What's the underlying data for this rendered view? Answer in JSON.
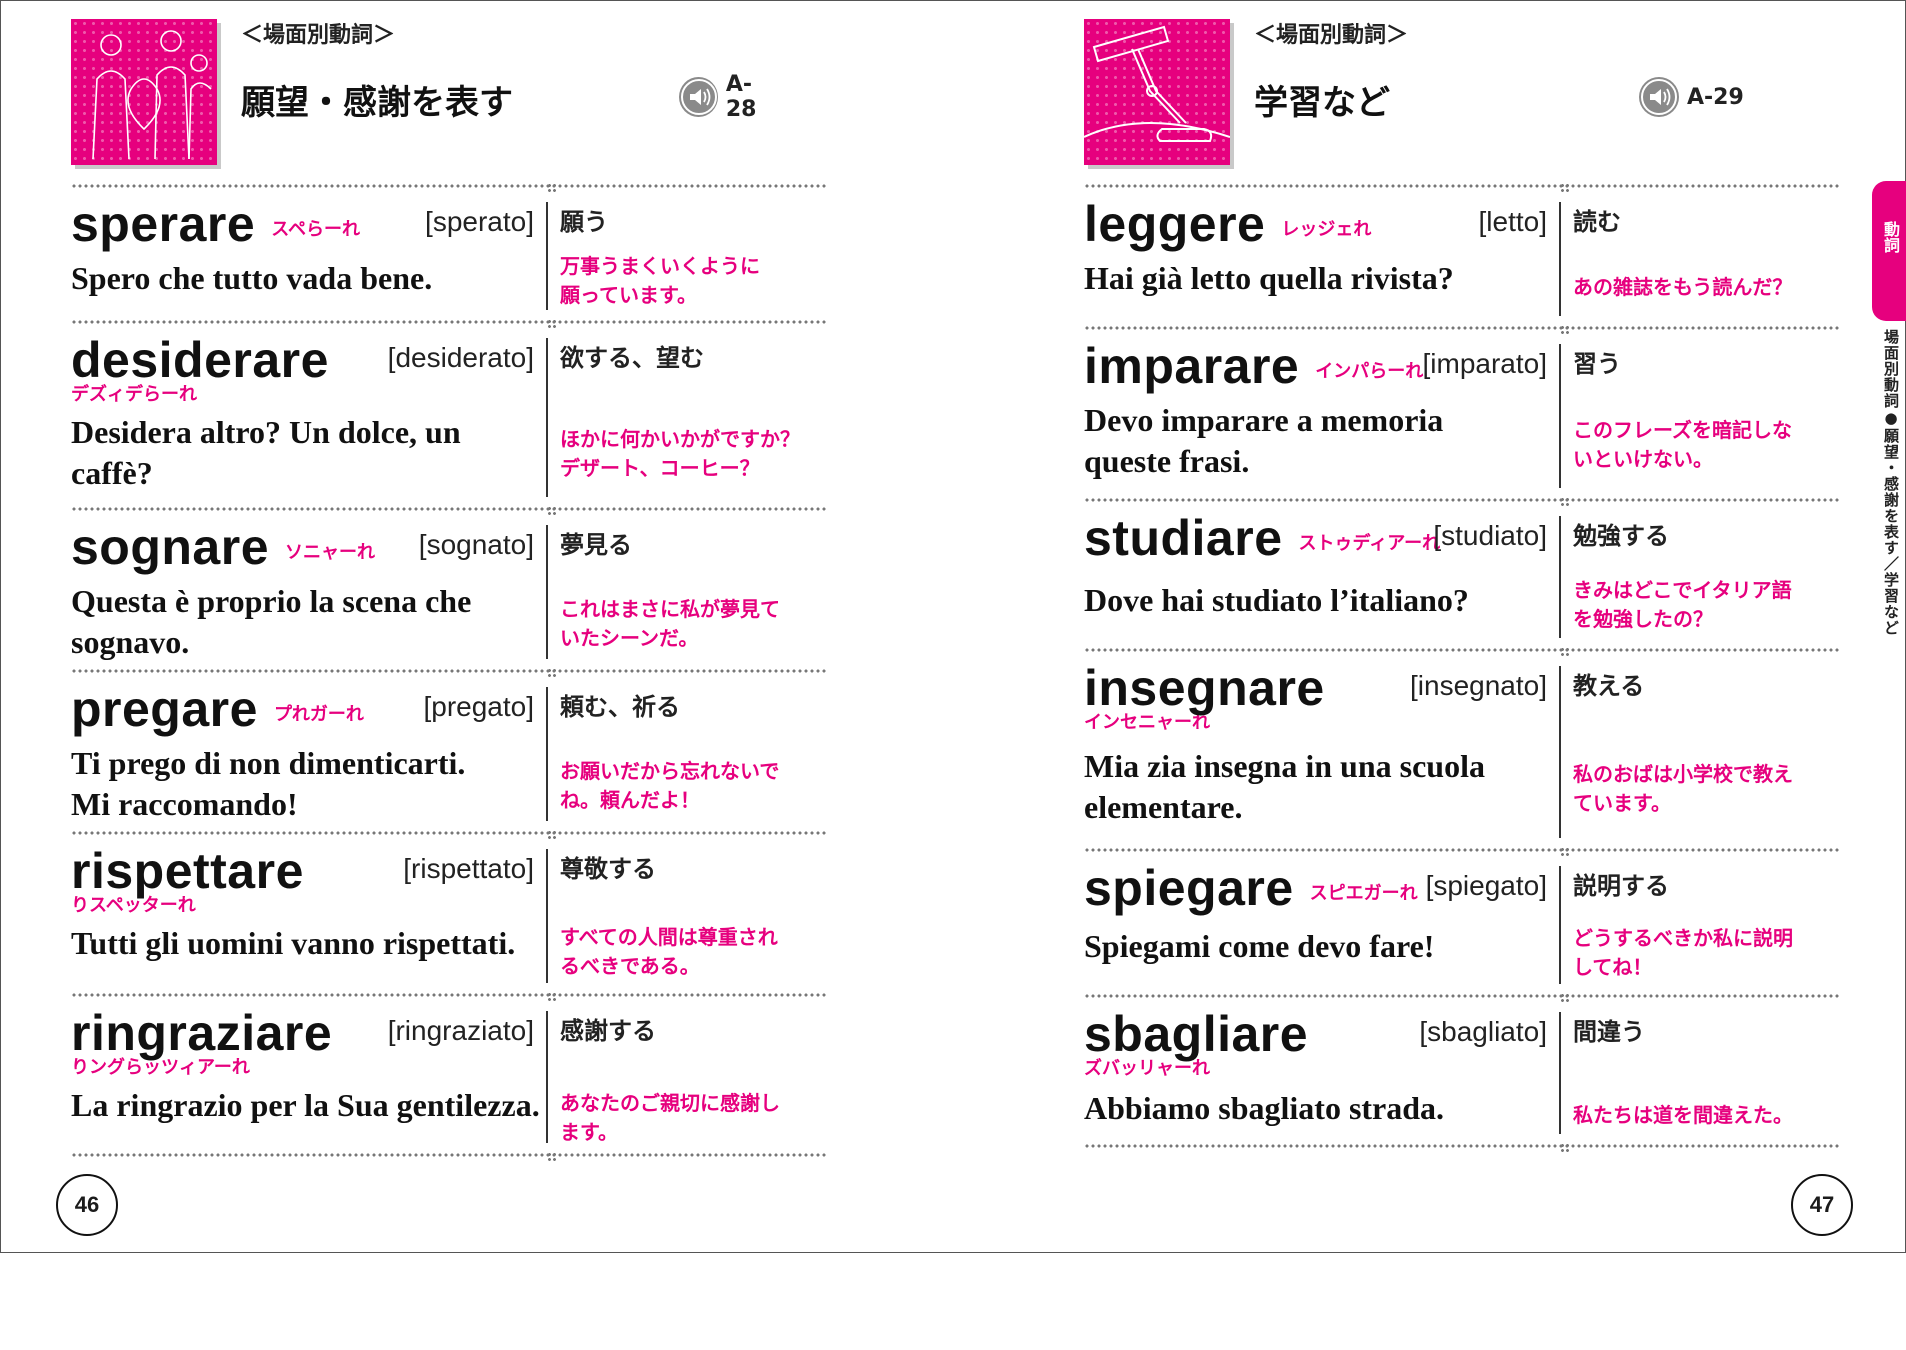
{
  "left_page": {
    "category": "＜場面別動詞＞",
    "title": "願望・感謝を表す",
    "audio_track": "A-28",
    "page_number": "46",
    "entries": [
      {
        "verb": "sperare",
        "kana": "スペらーれ",
        "kana_below": false,
        "participle": "[sperato]",
        "sentence": [
          "Spero che tutto vada bene."
        ],
        "meaning": "願う",
        "translation": [
          "万事うまくいくように",
          "願っています。"
        ]
      },
      {
        "verb": "desiderare",
        "kana": "デズィデらーれ",
        "kana_below": true,
        "participle": "[desiderato]",
        "sentence": [
          "Desidera altro?  Un dolce, un",
          "caffè?"
        ],
        "meaning": "欲する、望む",
        "translation": [
          "ほかに何かいかがですか？",
          "デザート、コーヒー？"
        ]
      },
      {
        "verb": "sognare",
        "kana": "ソニャーれ",
        "kana_below": false,
        "participle": "[sognato]",
        "sentence": [
          "Questa è proprio la scena che",
          "sognavo."
        ],
        "meaning": "夢見る",
        "translation": [
          "これはまさに私が夢見て",
          "いたシーンだ。"
        ]
      },
      {
        "verb": "pregare",
        "kana": "プれガーれ",
        "kana_below": false,
        "participle": "[pregato]",
        "sentence": [
          "Ti prego di non dimenticarti.",
          "Mi raccomando!"
        ],
        "meaning": "頼む、祈る",
        "translation": [
          "お願いだから忘れないで",
          "ね。頼んだよ！"
        ]
      },
      {
        "verb": "rispettare",
        "kana": "りスペッターれ",
        "kana_below": true,
        "participle": "[rispettato]",
        "sentence": [
          "Tutti gli uomini vanno rispettati."
        ],
        "meaning": "尊敬する",
        "translation": [
          "すべての人間は尊重され",
          "るべきである。"
        ]
      },
      {
        "verb": "ringraziare",
        "kana": "りングらッツィアーれ",
        "kana_below": true,
        "participle": "[ringraziato]",
        "sentence": [
          "La ringrazio per la Sua gentilezza."
        ],
        "meaning": "感謝する",
        "translation": [
          "あなたのご親切に感謝し",
          "ます。"
        ]
      }
    ]
  },
  "right_page": {
    "category": "＜場面別動詞＞",
    "title": "学習など",
    "audio_track": "A-29",
    "page_number": "47",
    "side_tab_label": "動詞",
    "side_text": "場面別動詞●願望・感謝を表す／学習など",
    "entries": [
      {
        "verb": "leggere",
        "kana": "レッジェれ",
        "kana_below": false,
        "participle": "[letto]",
        "sentence": [
          "Hai già letto quella rivista?"
        ],
        "meaning": "読む",
        "translation": [
          "あの雑誌をもう読んだ？"
        ]
      },
      {
        "verb": "imparare",
        "kana": "インパらーれ",
        "kana_below": false,
        "participle": "[imparato]",
        "sentence": [
          "Devo imparare a memoria",
          "queste frasi."
        ],
        "meaning": "習う",
        "translation": [
          "このフレーズを暗記しな",
          "いといけない。"
        ]
      },
      {
        "verb": "studiare",
        "kana": "ストゥディアーれ",
        "kana_below": false,
        "participle": "[studiato]",
        "sentence": [
          "Dove hai studiato l’italiano?"
        ],
        "meaning": "勉強する",
        "translation": [
          "きみはどこでイタリア語",
          "を勉強したの？"
        ]
      },
      {
        "verb": "insegnare",
        "kana": "インセニャーれ",
        "kana_below": true,
        "participle": "[insegnato]",
        "sentence": [
          "Mia zia insegna in una scuola",
          "elementare."
        ],
        "meaning": "教える",
        "translation": [
          "私のおばは小学校で教え",
          "ています。"
        ]
      },
      {
        "verb": "spiegare",
        "kana": "スピエガーれ",
        "kana_below": false,
        "participle": "[spiegato]",
        "sentence": [
          "Spiegami come devo fare!"
        ],
        "meaning": "説明する",
        "translation": [
          "どうするべきか私に説明",
          "してね！"
        ]
      },
      {
        "verb": "sbagliare",
        "kana": "ズバッリャーれ",
        "kana_below": true,
        "participle": "[sbagliato]",
        "sentence": [
          "Abbiamo sbagliato strada."
        ],
        "meaning": "間違う",
        "translation": [
          "私たちは道を間違えた。"
        ]
      }
    ]
  },
  "colors": {
    "accent": "#e6007e",
    "rule": "#777777",
    "text": "#111111"
  }
}
